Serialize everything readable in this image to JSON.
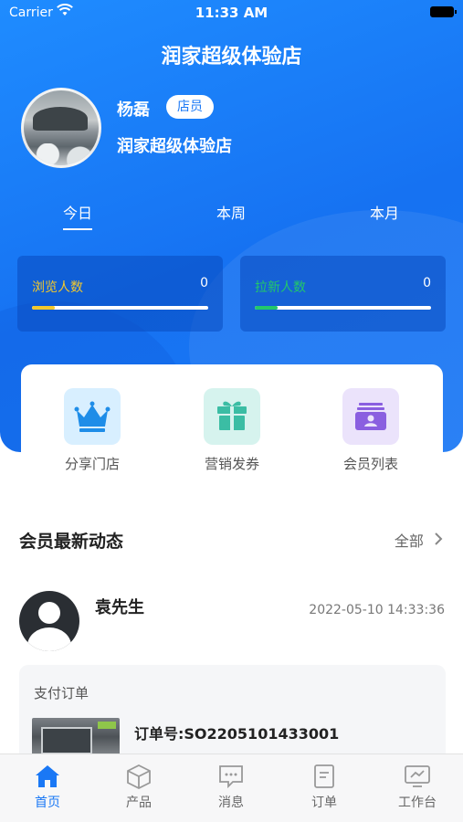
{
  "status_bar": {
    "carrier": "Carrier",
    "time": "11:33 AM"
  },
  "header": {
    "store_title": "润家超级体验店"
  },
  "profile": {
    "name": "杨磊",
    "role": "店员",
    "store": "润家超级体验店"
  },
  "period_tabs": [
    {
      "label": "今日",
      "active": true
    },
    {
      "label": "本周",
      "active": false
    },
    {
      "label": "本月",
      "active": false
    }
  ],
  "stats": [
    {
      "label": "浏览人数",
      "value": "0",
      "color": "#f2c82c",
      "fill": 0.13
    },
    {
      "label": "拉新人数",
      "value": "0",
      "color": "#22c76a",
      "fill": 0.13
    }
  ],
  "quick_actions": [
    {
      "label": "分享门店",
      "icon": "crown-icon",
      "bg": "#d8efff",
      "color": "#1e8de8"
    },
    {
      "label": "营销发券",
      "icon": "gift-icon",
      "bg": "#d6f3ee",
      "color": "#3bbda4"
    },
    {
      "label": "会员列表",
      "icon": "member-card-icon",
      "bg": "#ebe3fb",
      "color": "#8a5fe0"
    }
  ],
  "activity_section": {
    "title": "会员最新动态",
    "more_label": "全部"
  },
  "activity": {
    "member_name": "袁先生",
    "timestamp": "2022-05-10 14:33:36",
    "order_type": "支付订单",
    "order_number": "订单号:SO2205101433001"
  },
  "tabbar": [
    {
      "label": "首页",
      "icon": "home-icon",
      "active": true
    },
    {
      "label": "产品",
      "icon": "cube-icon",
      "active": false
    },
    {
      "label": "消息",
      "icon": "chat-icon",
      "active": false
    },
    {
      "label": "订单",
      "icon": "order-icon",
      "active": false
    },
    {
      "label": "工作台",
      "icon": "workbench-icon",
      "active": false
    }
  ],
  "colors": {
    "primary": "#1a78f5",
    "inactive": "#999999"
  }
}
